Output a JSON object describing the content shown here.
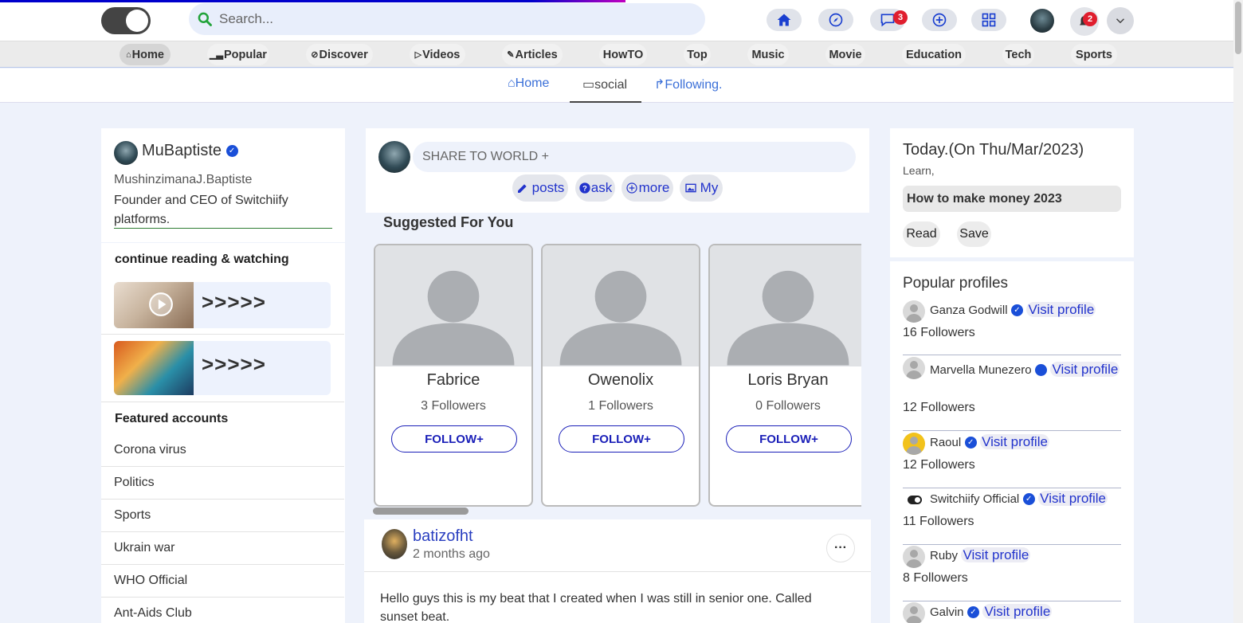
{
  "search": {
    "placeholder": "Search..."
  },
  "top_nav": {
    "messages_badge": "3",
    "notifications_badge": "2"
  },
  "categories": [
    {
      "label": "Home",
      "icon": "home-icon"
    },
    {
      "label": "Popular",
      "icon": "bars-icon"
    },
    {
      "label": "Discover",
      "icon": "compass-icon"
    },
    {
      "label": "Videos",
      "icon": "play-icon"
    },
    {
      "label": "Articles",
      "icon": "edit-icon"
    },
    {
      "label": "HowTO"
    },
    {
      "label": "Top"
    },
    {
      "label": "Music"
    },
    {
      "label": "Movie"
    },
    {
      "label": "Education"
    },
    {
      "label": "Tech"
    },
    {
      "label": "Sports"
    }
  ],
  "subnav": {
    "home": "Home",
    "social": "social",
    "following": "Following."
  },
  "profile": {
    "username": "MuBaptiste",
    "fullname": "MushinzimanaJ.Baptiste",
    "bio": "Founder and CEO of Switchiify platforms."
  },
  "continue": {
    "title": "continue reading & watching",
    "items": [
      {
        "arrows": ">>>>>"
      },
      {
        "arrows": ">>>>>"
      }
    ]
  },
  "featured": {
    "title": "Featured accounts",
    "items": [
      "Corona virus",
      "Politics",
      "Sports",
      "Ukrain war",
      "WHO Official",
      "Ant-Aids Club"
    ]
  },
  "composer": {
    "placeholder": "SHARE TO WORLD +",
    "buttons": {
      "posts": "posts",
      "ask": "ask",
      "more": "more",
      "my": "My"
    }
  },
  "suggested": {
    "title": "Suggested For You",
    "follow_label": "FOLLOW+",
    "people": [
      {
        "name": "Fabrice",
        "followers": "3 Followers"
      },
      {
        "name": "Owenolix",
        "followers": "1 Followers"
      },
      {
        "name": "Loris Bryan",
        "followers": "0 Followers"
      }
    ]
  },
  "post": {
    "author": "batizofht",
    "time": "2 months ago",
    "text": "Hello guys this is my beat that I created when I was still in senior one. Called sunset beat."
  },
  "today": {
    "title": "Today.(On Thu/Mar/2023)",
    "learn": "Learn,",
    "headline": "How to make money 2023",
    "read": "Read",
    "save": "Save"
  },
  "popular": {
    "title": "Popular profiles",
    "visit_label": "Visit profile",
    "profiles": [
      {
        "name": "Ganza Godwill",
        "followers": "16 Followers"
      },
      {
        "name": "Marvella Munezero",
        "followers": "12 Followers"
      },
      {
        "name": "Raoul",
        "followers": "12 Followers"
      },
      {
        "name": "Switchiify Official",
        "followers": "11 Followers"
      },
      {
        "name": "Ruby",
        "followers": "8 Followers"
      },
      {
        "name": "Galvin",
        "followers": ""
      }
    ]
  },
  "colors": {
    "accent": "#2233cc",
    "link": "#3a6fd8",
    "badge": "#e01e2e",
    "verified": "#1a4fd8"
  }
}
